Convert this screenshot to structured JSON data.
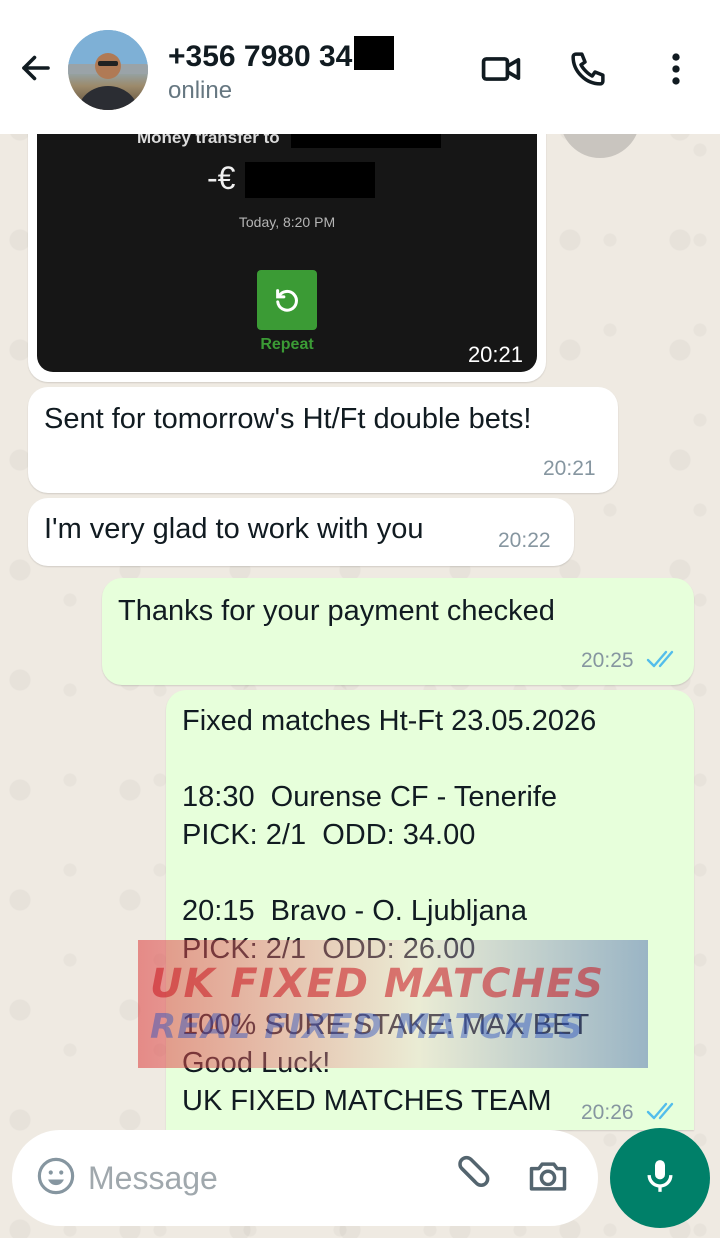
{
  "header": {
    "contact_name": "+356 7980 34",
    "status": "online",
    "icons": [
      "back-arrow-icon",
      "video-call-icon",
      "voice-call-icon",
      "more-options-icon"
    ]
  },
  "image_message": {
    "title": "Money transfer to",
    "amount_prefix": "-€",
    "date": "Today, 8:20 PM",
    "button_label": "Repeat",
    "time": "20:21"
  },
  "messages": [
    {
      "direction": "incoming",
      "text": "Sent for tomorrow's Ht/Ft double bets!",
      "time": "20:21"
    },
    {
      "direction": "incoming",
      "text": "I'm very glad to work with you",
      "time": "20:22"
    },
    {
      "direction": "outgoing",
      "text": "Thanks for your payment checked",
      "time": "20:25",
      "status": "read"
    },
    {
      "direction": "outgoing",
      "line1": "Fixed matches Ht-Ft 23.05.2026",
      "line2": "18:30  Ourense CF - Tenerife",
      "line3": "PICK: 2/1  ODD: 34.00",
      "line4": "20:15  Bravo - O. Ljubljana",
      "line5": "PICK: 2/1  ODD: 26.00",
      "line6": "100% SURE STAKE: MAX BET",
      "line7": "Good Luck!",
      "line8": "UK FIXED MATCHES TEAM",
      "time": "20:26",
      "status": "read"
    }
  ],
  "watermark": {
    "line1": "UK FIXED MATCHES",
    "line2": "REAL FIXED MATCHES"
  },
  "composer": {
    "placeholder": "Message"
  },
  "colors": {
    "accent": "#008069",
    "outgoing_bubble": "#e7ffdb",
    "read_tick": "#53bdeb",
    "background": "#efeae2"
  }
}
